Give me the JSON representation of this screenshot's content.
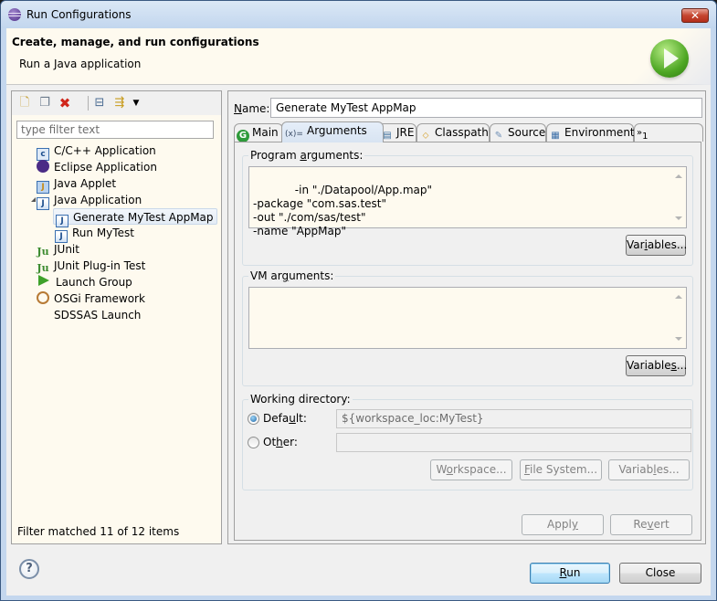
{
  "window": {
    "title": "Run Configurations",
    "close_label": "✕"
  },
  "banner": {
    "title": "Create, manage, and run configurations",
    "subtitle": "Run a Java application"
  },
  "left_panel": {
    "toolbar": {
      "new": "new-launch-configuration",
      "duplicate": "duplicate",
      "delete": "delete",
      "collapse_all": "collapse-all",
      "filter": "filter-launch-configurations"
    },
    "filter_placeholder": "type filter text",
    "tree": [
      {
        "label": "C/C++ Application",
        "icon": "c-icon",
        "glyph": "c"
      },
      {
        "label": "Eclipse Application",
        "icon": "eclipse-icon",
        "glyph": ""
      },
      {
        "label": "Java Applet",
        "icon": "java-applet-icon",
        "glyph": "J"
      },
      {
        "label": "Java Application",
        "icon": "java-application-icon",
        "glyph": "J",
        "expanded": true
      },
      {
        "label": "Generate MyTest AppMap",
        "icon": "java-application-icon",
        "glyph": "J",
        "selected": true
      },
      {
        "label": "Run MyTest",
        "icon": "java-application-icon",
        "glyph": "J"
      },
      {
        "label": "JUnit",
        "icon": "junit-icon",
        "glyph": "Ju"
      },
      {
        "label": "JUnit Plug-in Test",
        "icon": "junit-plugin-icon",
        "glyph": "Ju"
      },
      {
        "label": "Launch Group",
        "icon": "launch-group-icon",
        "glyph": ""
      },
      {
        "label": "OSGi Framework",
        "icon": "osgi-icon",
        "glyph": ""
      },
      {
        "label": "SDSSAS Launch",
        "icon": "",
        "glyph": ""
      }
    ],
    "filter_status": "Filter matched 11 of 12 items"
  },
  "right_panel": {
    "name_label": "Name:",
    "name_value": "Generate MyTest AppMap",
    "tabs": [
      {
        "label": "Main",
        "icon": "main-tab-icon",
        "glyph": "G"
      },
      {
        "label": "Arguments",
        "icon": "arguments-tab-icon",
        "glyph": "(x)=",
        "active": true
      },
      {
        "label": "JRE",
        "icon": "jre-tab-icon",
        "glyph": "▤"
      },
      {
        "label": "Classpath",
        "icon": "classpath-tab-icon",
        "glyph": "⬦"
      },
      {
        "label": "Source",
        "icon": "source-tab-icon",
        "glyph": "✎"
      },
      {
        "label": "Environment",
        "icon": "environment-tab-icon",
        "glyph": "▦"
      }
    ],
    "more_tabs": {
      "glyph": "»",
      "count": "1"
    },
    "program_arguments": {
      "label": "Program arguments:",
      "value": "-in \"./Datapool/App.map\"\n-package \"com.sas.test\"\n-out \"./com/sas/test\"\n-name \"AppMap\"",
      "variables_button": "Variables..."
    },
    "vm_arguments": {
      "label": "VM arguments:",
      "value": "",
      "variables_button": "Variables..."
    },
    "working_directory": {
      "label": "Working directory:",
      "default_label": "Default:",
      "default_value": "${workspace_loc:MyTest}",
      "default_selected": true,
      "other_label": "Other:",
      "other_value": "",
      "workspace_button": "Workspace...",
      "filesystem_button": "File System...",
      "variables_button": "Variables..."
    },
    "apply_button": "Apply",
    "revert_button": "Revert"
  },
  "footer": {
    "help_glyph": "?",
    "run_button": "Run",
    "close_button": "Close"
  }
}
